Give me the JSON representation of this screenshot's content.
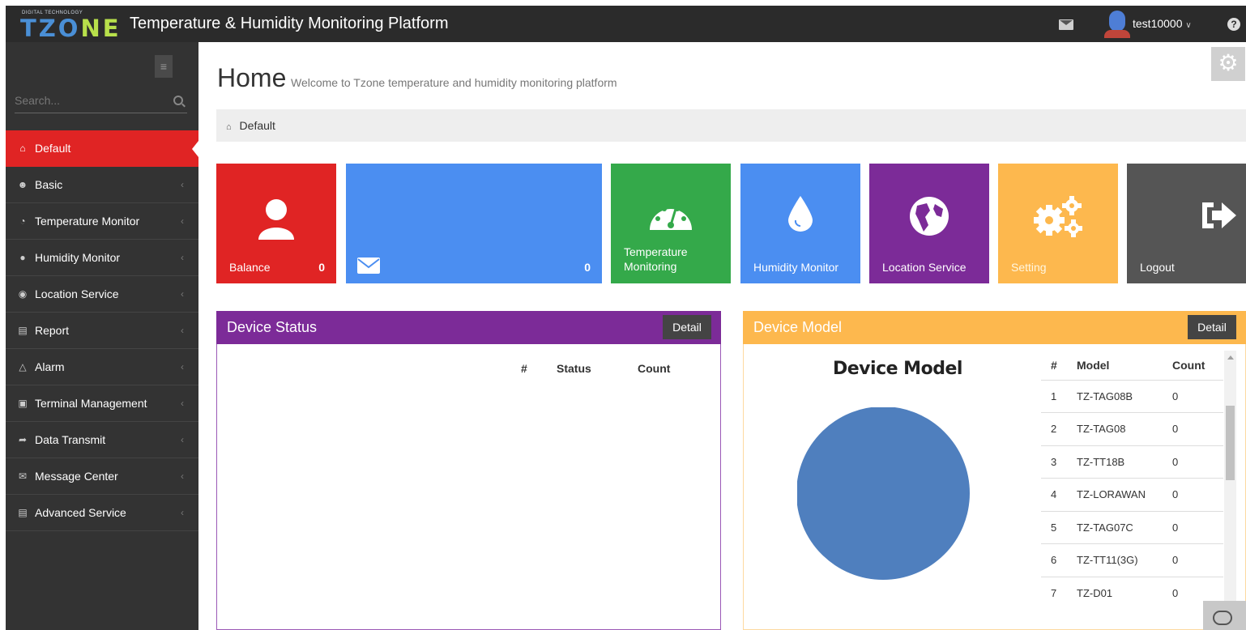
{
  "header": {
    "logo_tagline": "DIGITAL TECHNOLOGY",
    "logo_word_a": "TZO",
    "logo_word_b": "NE",
    "title": "Temperature & Humidity Monitoring Platform",
    "username": "test10000",
    "help_glyph": "?"
  },
  "sidebar": {
    "search_placeholder": "Search...",
    "items": [
      {
        "label": "Default",
        "icon": "home-icon",
        "active": true
      },
      {
        "label": "Basic",
        "icon": "user-icon"
      },
      {
        "label": "Temperature Monitor",
        "icon": "gauge-icon"
      },
      {
        "label": "Humidity Monitor",
        "icon": "droplet-icon"
      },
      {
        "label": "Location Service",
        "icon": "globe-icon"
      },
      {
        "label": "Report",
        "icon": "bar-chart-icon"
      },
      {
        "label": "Alarm",
        "icon": "bell-icon"
      },
      {
        "label": "Terminal Management",
        "icon": "briefcase-icon"
      },
      {
        "label": "Data Transmit",
        "icon": "share-icon"
      },
      {
        "label": "Message Center",
        "icon": "envelope-icon"
      },
      {
        "label": "Advanced Service",
        "icon": "cart-icon"
      }
    ]
  },
  "page": {
    "title": "Home",
    "subtitle": "Welcome to Tzone temperature and humidity monitoring platform",
    "breadcrumb": "Default"
  },
  "tiles": [
    {
      "label": "Balance",
      "count": "0",
      "color": "#e02424",
      "icon": "user-icon"
    },
    {
      "label": "",
      "count": "0",
      "color": "#4b8ef1",
      "icon": "envelope-icon"
    },
    {
      "label": "Temperature Monitoring",
      "count": "",
      "color": "#34a94a",
      "icon": "gauge-icon"
    },
    {
      "label": "Humidity Monitor",
      "count": "",
      "color": "#4b8ef1",
      "icon": "droplet-icon"
    },
    {
      "label": "Location Service",
      "count": "",
      "color": "#7c2b98",
      "icon": "globe-icon"
    },
    {
      "label": "Setting",
      "count": "",
      "color": "#fdb84e",
      "icon": "gears-icon"
    },
    {
      "label": "Logout",
      "count": "",
      "color": "#555555",
      "icon": "logout-icon"
    }
  ],
  "device_status": {
    "title": "Device Status",
    "detail_label": "Detail",
    "color": "#7c2b98",
    "columns": [
      "#",
      "Status",
      "Count"
    ]
  },
  "device_model": {
    "title": "Device Model",
    "detail_label": "Detail",
    "color": "#fdb84e",
    "pie_color": "#4f7fbe",
    "columns": [
      "#",
      "Model",
      "Count"
    ],
    "rows": [
      {
        "n": "1",
        "model": "TZ-TAG08B",
        "count": "0"
      },
      {
        "n": "2",
        "model": "TZ-TAG08",
        "count": "0"
      },
      {
        "n": "3",
        "model": "TZ-TT18B",
        "count": "0"
      },
      {
        "n": "4",
        "model": "TZ-LORAWAN",
        "count": "0"
      },
      {
        "n": "5",
        "model": "TZ-TAG07C",
        "count": "0"
      },
      {
        "n": "6",
        "model": "TZ-TT11(3G)",
        "count": "0"
      },
      {
        "n": "7",
        "model": "TZ-D01",
        "count": "0"
      }
    ]
  },
  "chart_data": {
    "type": "pie",
    "title": "Device Model",
    "categories": [
      "TZ-TAG08B",
      "TZ-TAG08",
      "TZ-TT18B",
      "TZ-LORAWAN",
      "TZ-TAG07C",
      "TZ-TT11(3G)",
      "TZ-D01"
    ],
    "values": [
      0,
      0,
      0,
      0,
      0,
      0,
      0
    ]
  }
}
